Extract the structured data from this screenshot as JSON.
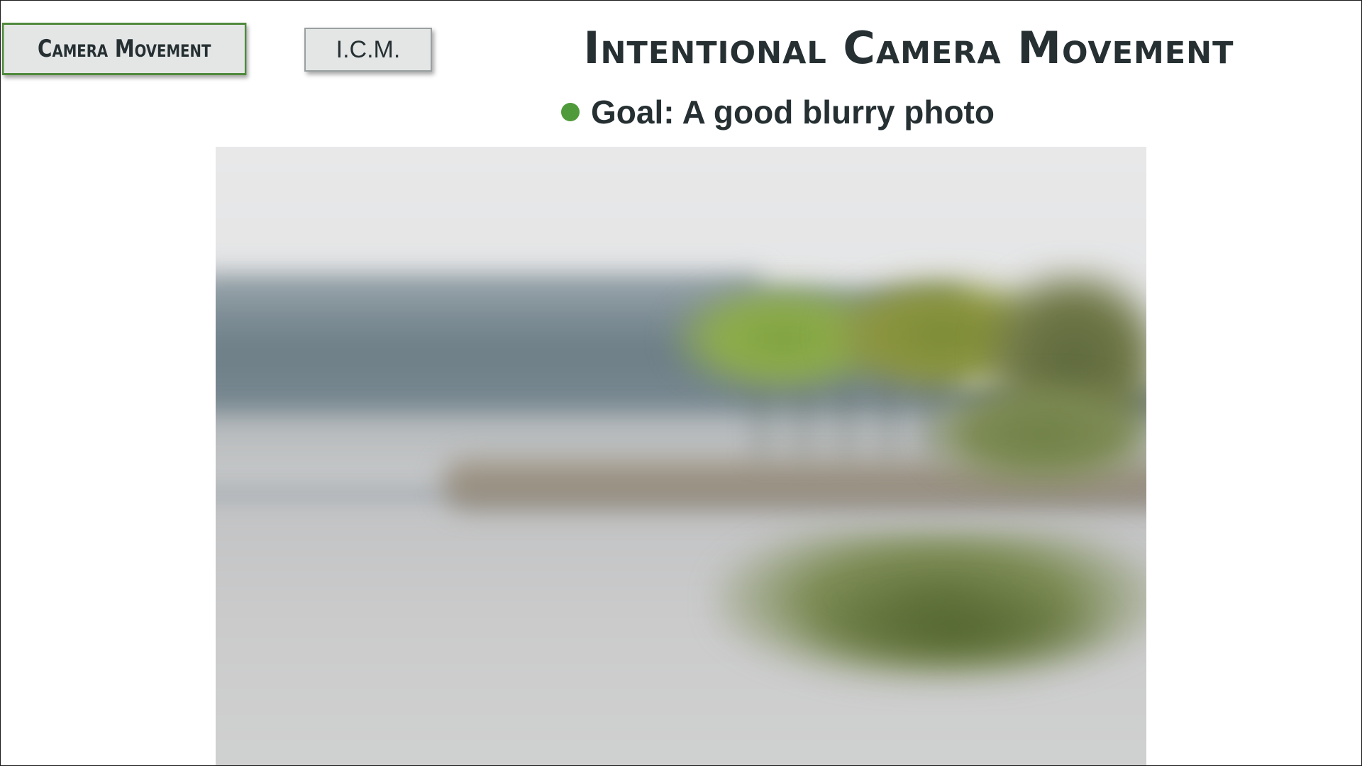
{
  "header": {
    "section_tab": "Camera Movement",
    "sub_tab": "I.C.M.",
    "title": "Intentional Camera Movement"
  },
  "bullets": [
    {
      "text": "Goal: A good blurry photo"
    }
  ],
  "colors": {
    "accent_green": "#4f9a3a",
    "tab_border": "#4f8a3c",
    "text_dark": "#263033",
    "tab_bg": "#e4e6e6"
  },
  "photo": {
    "description_icon": "blurry-landscape-photo"
  }
}
